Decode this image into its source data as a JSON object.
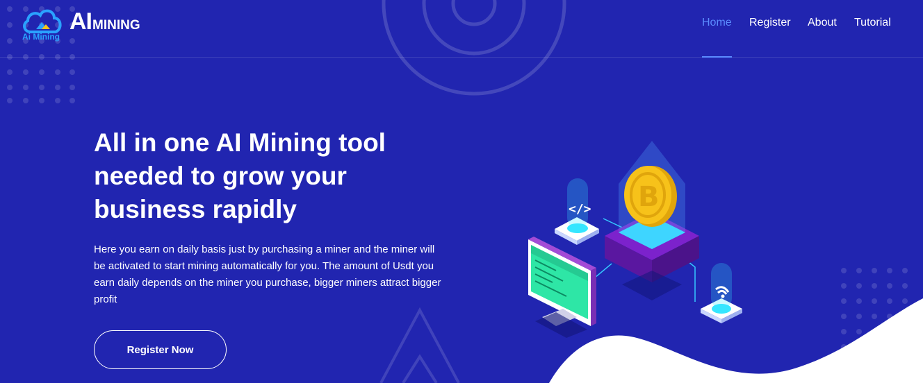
{
  "brand": {
    "name_big": "AI",
    "name_small": "MINING",
    "logo_text": "Ai Mining"
  },
  "nav": {
    "items": [
      {
        "label": "Home",
        "active": true
      },
      {
        "label": "Register",
        "active": false
      },
      {
        "label": "About",
        "active": false
      },
      {
        "label": "Tutorial",
        "active": false
      }
    ]
  },
  "hero": {
    "title": "All in one AI Mining tool needed to grow your business rapidly",
    "description": "Here you earn on daily basis just by purchasing a miner and the miner will be activated to start mining automatically for you. The amount of Usdt you earn daily depends on the miner you purchase, bigger miners attract bigger profit",
    "cta_label": "Register Now"
  },
  "colors": {
    "background": "#2125b0",
    "nav_active": "#5b8cff",
    "coin": "#f7c21a",
    "cyan": "#35e6ff"
  }
}
